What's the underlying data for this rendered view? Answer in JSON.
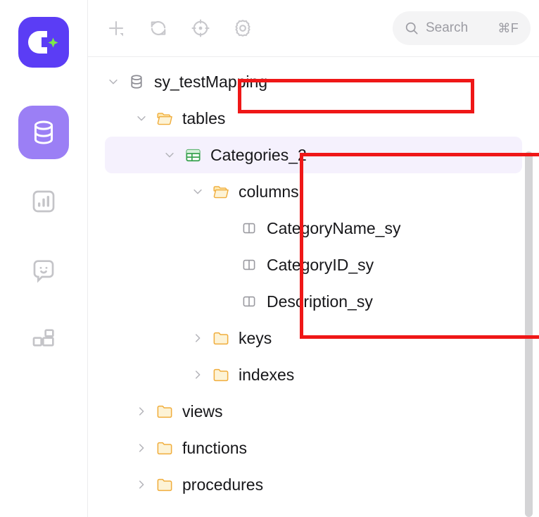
{
  "app": {
    "logo_name": "chat2db-logo",
    "accent_purple": "#5b3df5",
    "active_purple": "#9b7ff5",
    "annotation_color": "#ef1717",
    "selected_row_color": "#f5f1fd"
  },
  "rail": {
    "items": [
      {
        "name": "connections-database",
        "icon": "database-icon",
        "active": true
      },
      {
        "name": "dashboard-chart",
        "icon": "chart-bar-icon",
        "active": false
      },
      {
        "name": "ai-chat",
        "icon": "chat-smiley-icon",
        "active": false
      },
      {
        "name": "plugins",
        "icon": "blocks-grid-icon",
        "active": false
      }
    ]
  },
  "toolbar": {
    "buttons": [
      {
        "name": "add-connection-button",
        "icon": "plus-icon"
      },
      {
        "name": "refresh-button",
        "icon": "refresh-icon"
      },
      {
        "name": "locate-button",
        "icon": "crosshair-target-icon"
      },
      {
        "name": "settings-button",
        "icon": "gear-icon"
      }
    ],
    "search": {
      "icon": "search-icon",
      "placeholder": "Search",
      "shortcut": "⌘F"
    }
  },
  "tree": {
    "nodes": [
      {
        "label": "sy_testMapping",
        "icon": "database-icon",
        "depth": 0,
        "expanded": true,
        "selected": false,
        "highlighted": true
      },
      {
        "label": "tables",
        "icon": "folder-open-icon",
        "depth": 1,
        "expanded": true,
        "selected": false,
        "highlighted": false
      },
      {
        "label": "Categories_2",
        "icon": "table-icon",
        "depth": 2,
        "expanded": true,
        "selected": true,
        "highlighted": true
      },
      {
        "label": "columns",
        "icon": "folder-open-icon",
        "depth": 3,
        "expanded": true,
        "selected": false,
        "highlighted": false
      },
      {
        "label": "CategoryName_sy",
        "icon": "column-icon",
        "depth": 4,
        "expanded": null,
        "selected": false,
        "highlighted": false
      },
      {
        "label": "CategoryID_sy",
        "icon": "column-icon",
        "depth": 4,
        "expanded": null,
        "selected": false,
        "highlighted": false
      },
      {
        "label": "Description_sy",
        "icon": "column-icon",
        "depth": 4,
        "expanded": null,
        "selected": false,
        "highlighted": false
      },
      {
        "label": "keys",
        "icon": "folder-closed-icon",
        "depth": 3,
        "expanded": false,
        "selected": false,
        "highlighted": false
      },
      {
        "label": "indexes",
        "icon": "folder-closed-icon",
        "depth": 3,
        "expanded": false,
        "selected": false,
        "highlighted": false
      },
      {
        "label": "views",
        "icon": "folder-closed-icon",
        "depth": 1,
        "expanded": false,
        "selected": false,
        "highlighted": false
      },
      {
        "label": "functions",
        "icon": "folder-closed-icon",
        "depth": 1,
        "expanded": false,
        "selected": false,
        "highlighted": false
      },
      {
        "label": "procedures",
        "icon": "folder-closed-icon",
        "depth": 1,
        "expanded": false,
        "selected": false,
        "highlighted": false
      }
    ]
  },
  "annotations": [
    {
      "name": "highlight-box-database",
      "target": "sy_testMapping"
    },
    {
      "name": "highlight-box-table-columns",
      "target": "Categories_2"
    }
  ],
  "scrollbar": {
    "name": "tree-vertical-scrollbar",
    "orientation": "vertical"
  }
}
